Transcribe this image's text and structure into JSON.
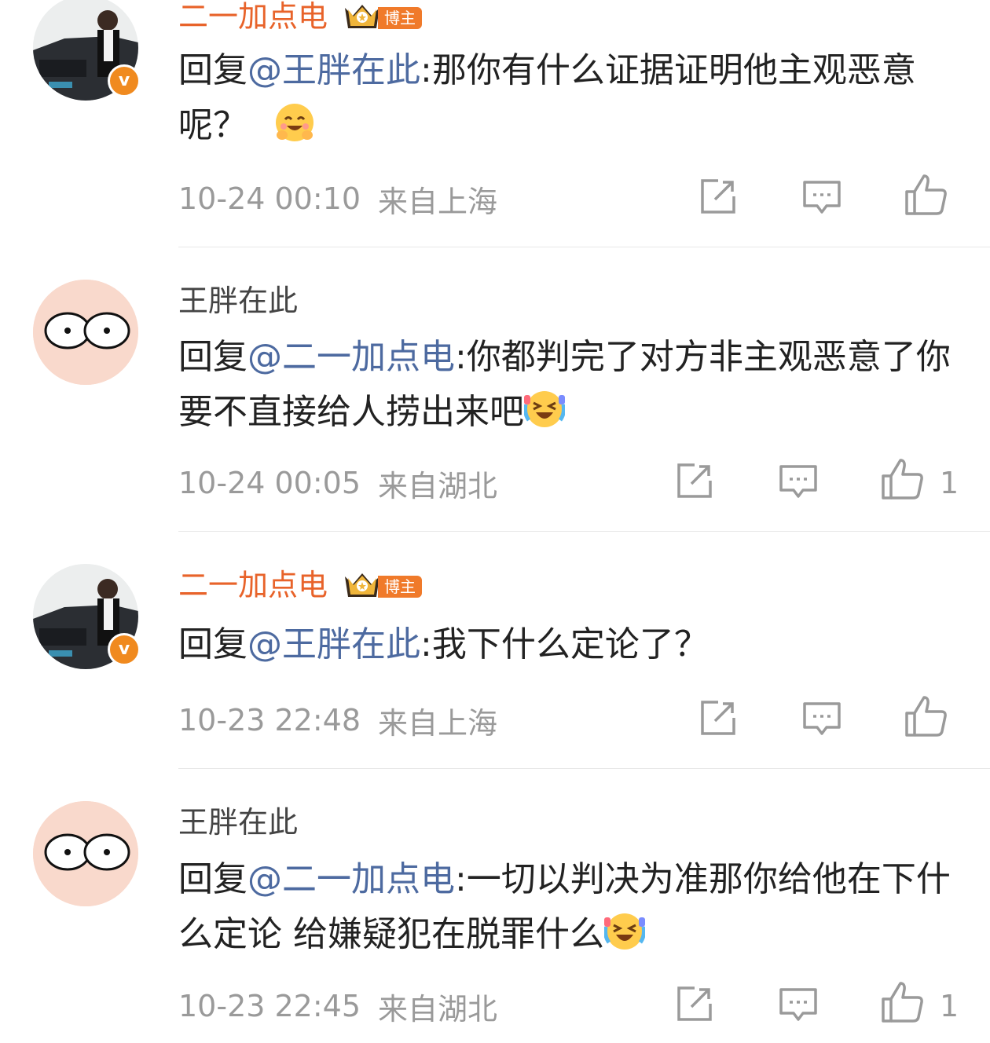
{
  "comments": [
    {
      "author": "二一加点电",
      "badge": "博主",
      "reply_prefix": "回复",
      "mention": "@王胖在此",
      "text": ":那你有什么证据证明他主观恶意呢？",
      "emoji": "grin-blush-emoji",
      "time": "10-24 00:10",
      "location": "来自上海",
      "like_count": ""
    },
    {
      "author": "王胖在此",
      "badge": "",
      "reply_prefix": "回复",
      "mention": "@二一加点电",
      "text": ":你都判完了对方非主观恶意了你要不直接给人捞出来吧",
      "emoji": "laugh-cry-emoji",
      "time": "10-24 00:05",
      "location": "来自湖北",
      "like_count": "1"
    },
    {
      "author": "二一加点电",
      "badge": "博主",
      "reply_prefix": "回复",
      "mention": "@王胖在此",
      "text": ":我下什么定论了？",
      "emoji": "",
      "time": "10-23 22:48",
      "location": "来自上海",
      "like_count": ""
    },
    {
      "author": "王胖在此",
      "badge": "",
      "reply_prefix": "回复",
      "mention": "@二一加点电",
      "text": ":一切以判决为准那你给他在下什么定论 给嫌疑犯在脱罪什么",
      "emoji": "laugh-cry-emoji",
      "time": "10-23 22:45",
      "location": "来自湖北",
      "like_count": "1"
    }
  ],
  "colors": {
    "blogger_name": "#e8632a",
    "mention": "#4d6aa0",
    "meta": "#9a9a9a",
    "badge_bg": "#f07a2a"
  }
}
